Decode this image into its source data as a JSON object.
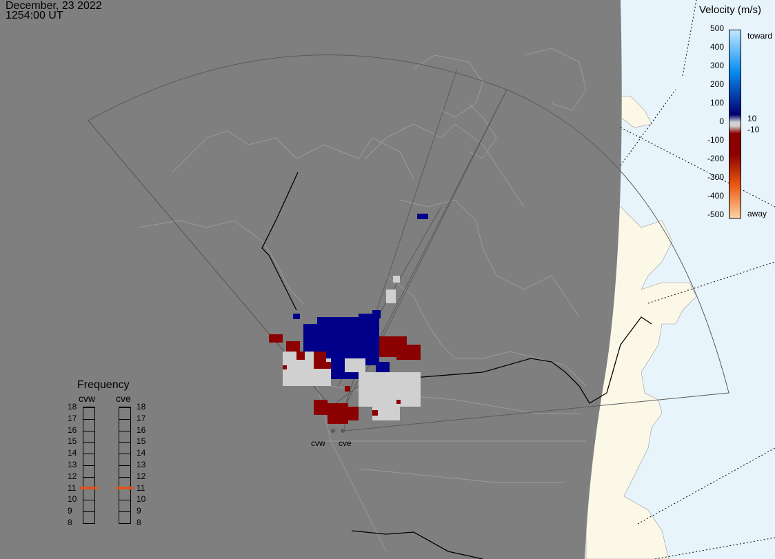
{
  "timestamp": {
    "date": "December, 23 2022",
    "time": "1254:00 UT"
  },
  "radars": [
    {
      "code": "cvw"
    },
    {
      "code": "cve"
    }
  ],
  "frequency_panel": {
    "title": "Frequency",
    "columns": [
      {
        "name": "cvw",
        "active_mhz": 11
      },
      {
        "name": "cve",
        "active_mhz": 11
      }
    ],
    "scale": [
      "18",
      "17",
      "16",
      "15",
      "14",
      "13",
      "12",
      "11",
      "10",
      "9",
      "8"
    ],
    "marker_color": "#e0521e"
  },
  "velocity_legend": {
    "title": "Velocity (m/s)",
    "ticks": [
      "500",
      "400",
      "300",
      "200",
      "100",
      "0",
      "-100",
      "-200",
      "-300",
      "-400",
      "-500"
    ],
    "threshold_labels": [
      "10",
      "-10"
    ],
    "toward_label": "toward",
    "away_label": "away",
    "colors": {
      "toward_high": "#bfe8ff",
      "toward_mid": "#0a8df0",
      "toward_low": "#00006e",
      "away_low": "#8b0000",
      "away_mid": "#e8560f",
      "away_high": "#ffd0a0",
      "ground_scatter": "#d0d0d0"
    }
  },
  "map_colors": {
    "night": "#7f7f7f",
    "land_day": "#fbf8e8",
    "ocean_day": "#e8f4fc",
    "borders_dark": "#000000",
    "fov_outline": "#5a5a5a"
  }
}
